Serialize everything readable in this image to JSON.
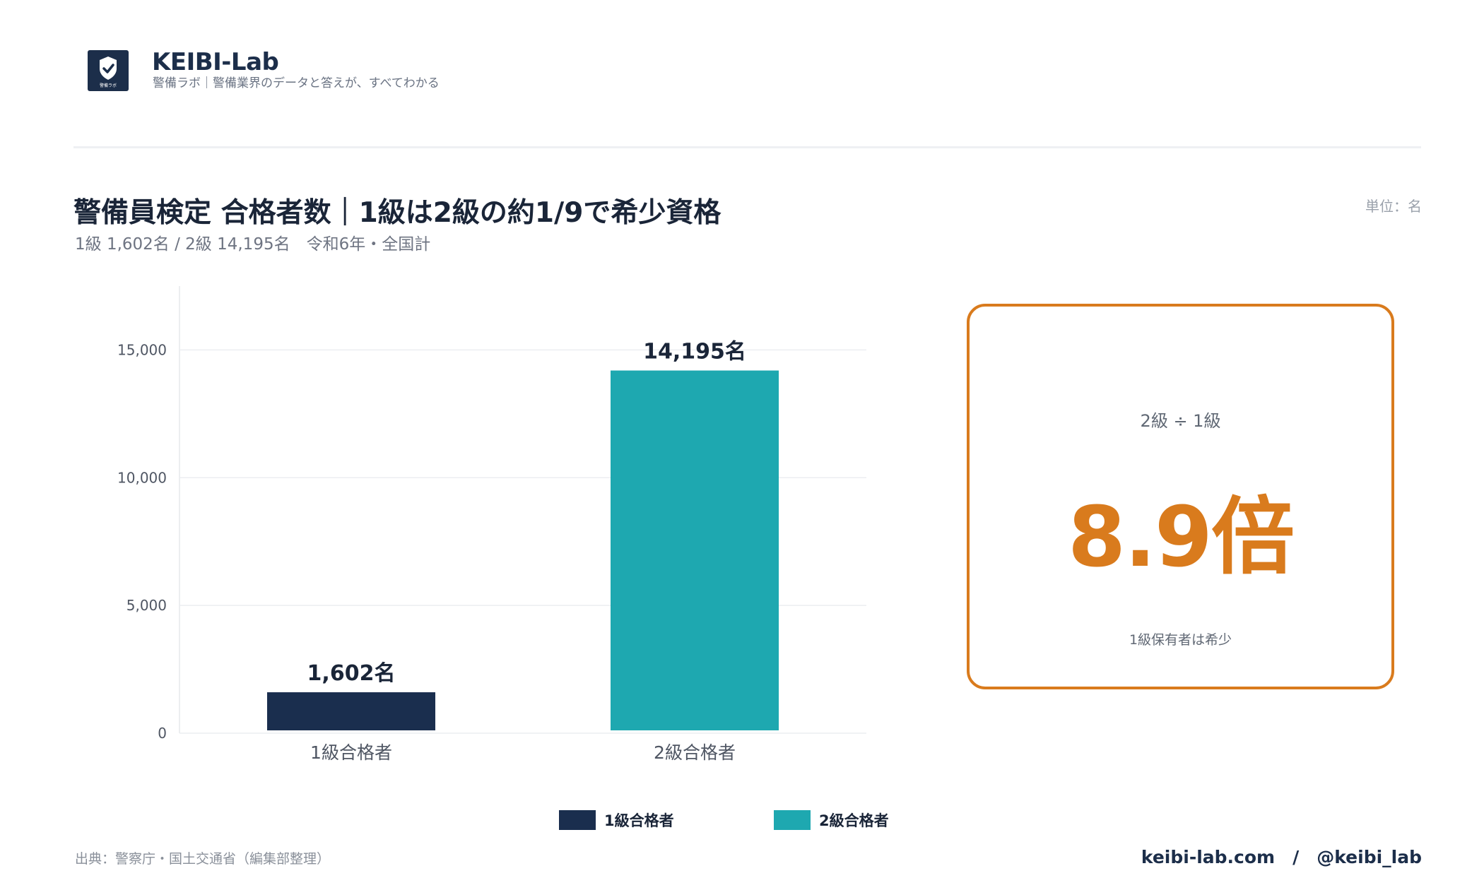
{
  "brand": {
    "name": "KEIBI-Lab",
    "tagline": "警備ラボ｜警備業界のデータと答えが、すべてわかる",
    "logo_icon": "shield-check-icon",
    "logo_text": "警備ラボ",
    "logo_color": "#1c2e4a"
  },
  "title": "警備員検定 合格者数｜1級は2級の約1/9で希少資格",
  "subtitle": "1級 1,602名 / 2級 14,195名　令和6年・全国計",
  "unit": "単位：名",
  "chart_data": {
    "type": "bar",
    "categories": [
      "1級合格者",
      "2級合格者"
    ],
    "values": [
      1602,
      14195
    ],
    "data_labels": [
      "1,602名",
      "14,195名"
    ],
    "colors": [
      "#1a2e4e",
      "#1ea8b0"
    ],
    "ylim": [
      0,
      17500
    ],
    "yticks": [
      0,
      5000,
      10000,
      15000
    ],
    "ytick_labels": [
      "0",
      "5,000",
      "10,000",
      "15,000"
    ],
    "grid": true,
    "legend_position": "bottom-center",
    "title": "",
    "xlabel": "",
    "ylabel": ""
  },
  "legend": [
    {
      "label": "1級合格者",
      "color": "#1a2e4e"
    },
    {
      "label": "2級合格者",
      "color": "#1ea8b0"
    }
  ],
  "ratio_card": {
    "label": "2級 ÷ 1級",
    "value": "8.9倍",
    "note": "1級保有者は希少",
    "accent_color": "#d97b1d"
  },
  "source": "出典：警察庁・国土交通省（編集部整理）",
  "footer": "keibi-lab.com　/　@keibi_lab"
}
